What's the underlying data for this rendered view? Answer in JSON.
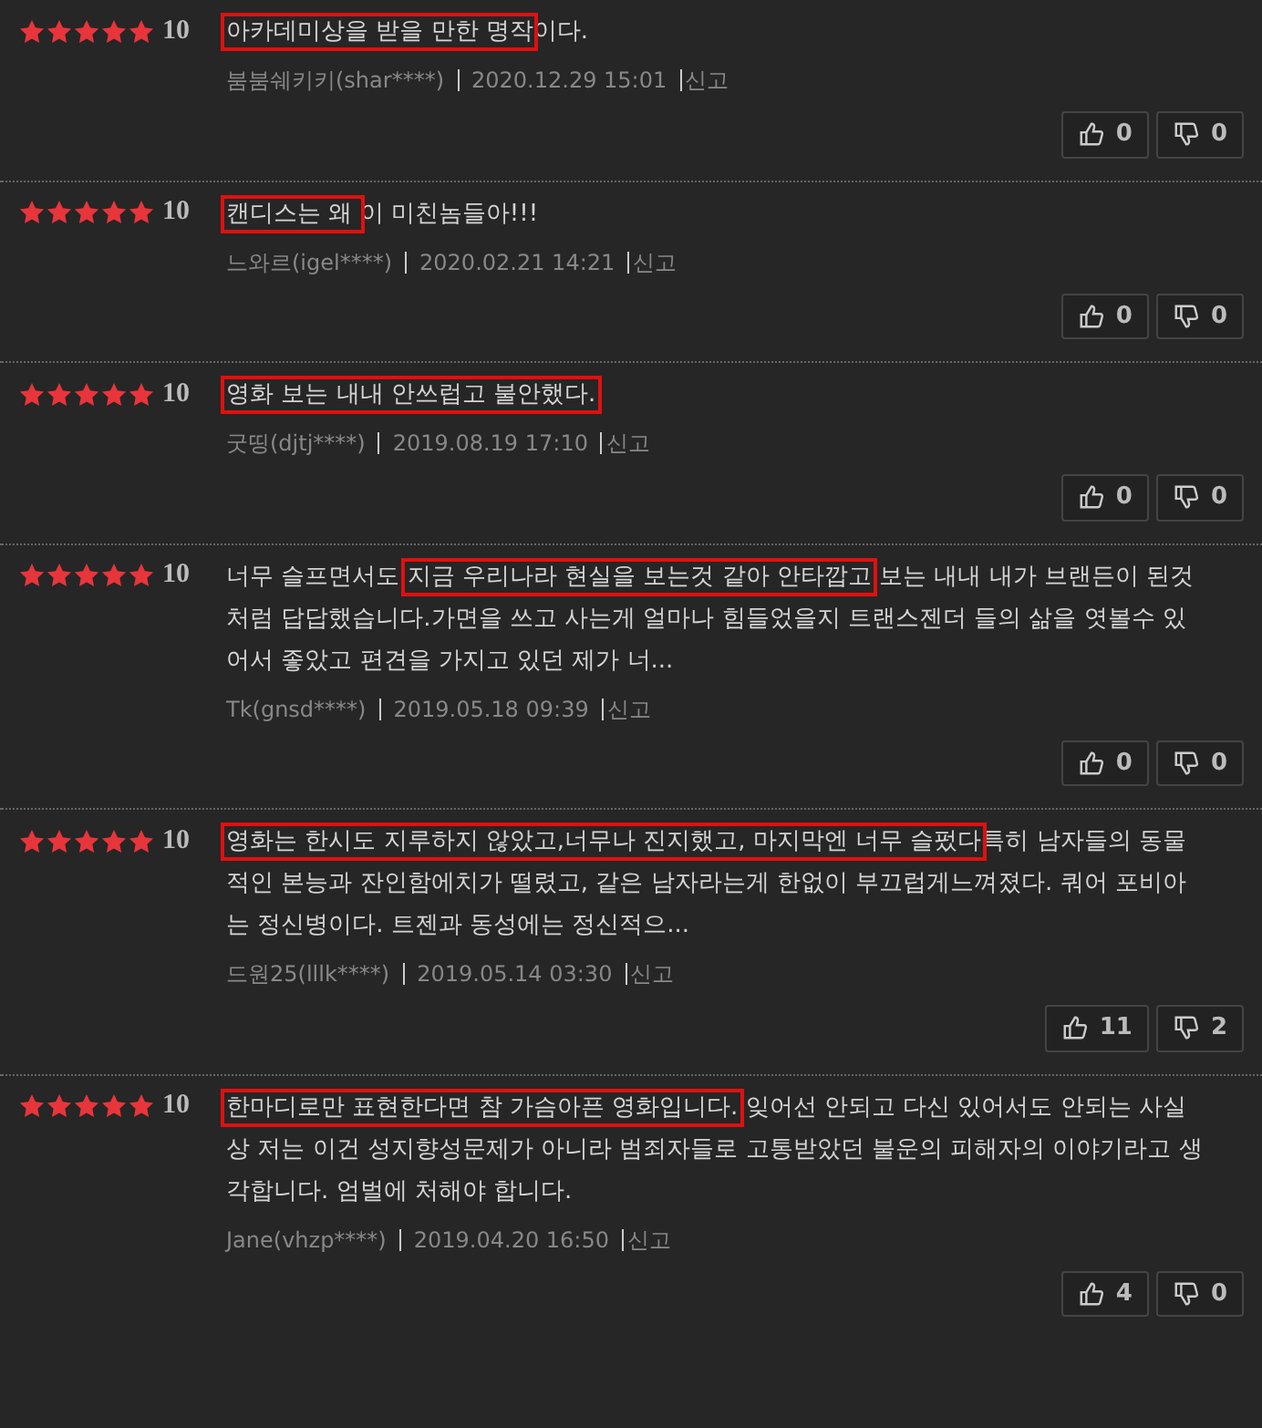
{
  "reviews": [
    {
      "stars": 5,
      "score": "10",
      "highlight": "아카데미상을 받을 만한 명작",
      "text": "이다.",
      "author": "붐붐쉐키키(shar****)",
      "date": "2020.12.29 15:01",
      "report": "신고",
      "likes": "0",
      "dislikes": "0"
    },
    {
      "stars": 5,
      "score": "10",
      "highlight": "캔디스는 왜 ",
      "text": "이 미친놈들아!!!",
      "author": "느와르(igel****)",
      "date": "2020.02.21 14:21",
      "report": "신고",
      "likes": "0",
      "dislikes": "0"
    },
    {
      "stars": 5,
      "score": "10",
      "highlight": "영화 보는 내내 안쓰럽고 불안했다.",
      "author": "굿띵(djtj****)",
      "date": "2019.08.19 17:10",
      "report": "신고",
      "likes": "0",
      "dislikes": "0"
    },
    {
      "stars": 5,
      "score": "10",
      "lead": "너무 슬프면서도 ",
      "highlight": "지금 우리나라 현실을 보는것 같아 안타깝고",
      "text": " 보는 내내 내가 브랜든이 된것 처럼 답답했습니다.가면을 쓰고 사는게 얼마나 힘들었을지 트랜스젠더 들의 삶을 엿볼수 있어서 좋았고 편견을 가지고 있던 제가 너...",
      "author": "Tk(gnsd****)",
      "date": "2019.05.18 09:39",
      "report": "신고",
      "likes": "0",
      "dislikes": "0"
    },
    {
      "stars": 5,
      "score": "10",
      "highlight": "영화는 한시도 지루하지 않았고,너무나 진지했고, 마지막엔 너무 슬펐다",
      "text": "특히 남자들의 동물적인 본능과 잔인함에치가 떨렸고, 같은 남자라는게 한없이 부끄럽게느껴졌다. 쿼어 포비아는 정신병이다. 트젠과 동성에는 정신적으...",
      "author": "드원25(lllk****)",
      "date": "2019.05.14 03:30",
      "report": "신고",
      "likes": "11",
      "dislikes": "2"
    },
    {
      "stars": 5,
      "score": "10",
      "highlight": "한마디로만 표현한다면 참 가슴아픈 영화입니다.",
      "text": " 잊어선 안되고 다신 있어서도 안되는 사실상 저는 이건 성지향성문제가 아니라 범죄자들로 고통받았던 불운의 피해자의 이야기라고 생각합니다. 엄벌에 처해야 합니다.",
      "author": "Jane(vhzp****)",
      "date": "2019.04.20 16:50",
      "report": "신고",
      "likes": "4",
      "dislikes": "0"
    }
  ]
}
